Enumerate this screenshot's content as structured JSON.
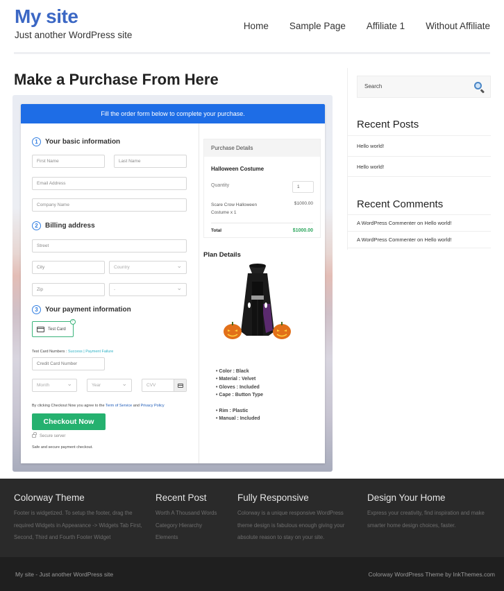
{
  "header": {
    "site_title": "My site",
    "tagline": "Just another WordPress site",
    "nav": [
      "Home",
      "Sample Page",
      "Affiliate 1",
      "Without Affiliate"
    ]
  },
  "page": {
    "title": "Make a Purchase From Here"
  },
  "form": {
    "banner": "Fill the order form below to complete your purchase.",
    "sections": [
      {
        "num": "1",
        "title": "Your basic information"
      },
      {
        "num": "2",
        "title": "Billing address"
      },
      {
        "num": "3",
        "title": "Your payment information"
      }
    ],
    "fields": {
      "first_name": "First Name",
      "last_name": "Last Name",
      "email": "Email Address",
      "company": "Company Name",
      "street": "Street",
      "city": "City",
      "country": "Country",
      "zip": "Zip",
      "state": "-",
      "card_number": "Credit Card Number",
      "month": "Month",
      "year": "Year",
      "cvv": "CVV"
    },
    "payment_method": "Test Card",
    "test_card_label": "Test Card Numbers : ",
    "success_link": "Success",
    "separator": " | ",
    "failure_link": "Payment Failure",
    "agree_prefix": "By clicking Checkout Now you agree to the ",
    "terms_link": "Term of Service",
    "and_text": " and ",
    "privacy_link": "Privacy Policy",
    "checkout_button": "Checkout Now",
    "secure_server": "Secure server",
    "secure_note": "Safe and secure payment checkout."
  },
  "purchase_details": {
    "heading": "Purchase Details",
    "product": "Halloween Costume",
    "quantity_label": "Quantity",
    "quantity": "1",
    "item": "Scare Crow Halloween Costume x 1",
    "item_price": "$1000.00",
    "total_label": "Total",
    "total": "$1000.00"
  },
  "plan_details": {
    "heading": "Plan Details",
    "features": [
      "Color : Black",
      "Material : Velvet",
      "Gloves : Included",
      "Cape : Button Type"
    ],
    "features_2": [
      "Rim : Plastic",
      "Manual : Included"
    ]
  },
  "sidebar": {
    "search_placeholder": "Search",
    "recent_posts_title": "Recent Posts",
    "recent_posts": [
      "Hello world!",
      "Hello world!"
    ],
    "recent_comments_title": "Recent Comments",
    "recent_comments": [
      {
        "author": "A WordPress Commenter",
        "on": " on ",
        "post": "Hello world!"
      },
      {
        "author": "A WordPress Commenter",
        "on": " on ",
        "post": "Hello world!"
      }
    ]
  },
  "footer": {
    "columns": [
      {
        "title": "Colorway Theme",
        "text": "Footer is widgetized. To setup the footer, drag the required Widgets in Appearance -> Widgets Tab First, Second, Third and Fourth Footer Widget"
      },
      {
        "title": "Recent Post",
        "links": [
          "Worth A Thousand Words",
          "Category Hierarchy",
          "Elements"
        ]
      },
      {
        "title": "Fully Responsive",
        "text": "Colorway is a unique responsive WordPress theme design is fabulous enough giving your absolute reason to stay on your site."
      },
      {
        "title": "Design Your Home",
        "text": "Express your creativity, find inspiration and make smarter home design choices, faster."
      }
    ],
    "bottom_left": "My site - Just another WordPress site",
    "bottom_right": "Colorway WordPress Theme by InkThemes.com"
  },
  "colors": {
    "site_title": "#3b67c4",
    "banner": "#1e6de6",
    "checkout": "#25b16f",
    "total": "#2aa55b",
    "footer_bg": "#2a2a2a"
  }
}
